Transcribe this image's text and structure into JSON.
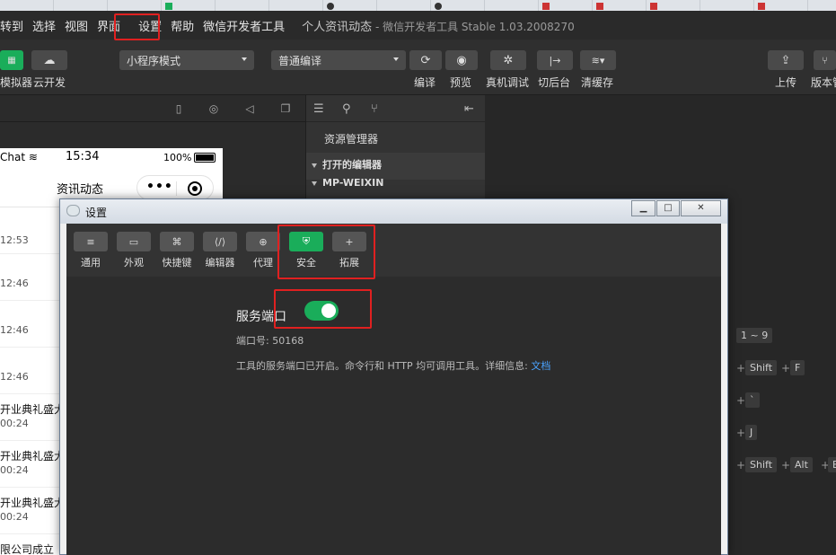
{
  "menubar": {
    "items": [
      "转到",
      "选择",
      "视图",
      "界面",
      "设置",
      "帮助",
      "微信开发者工具"
    ],
    "title": "个人资讯动态",
    "subtitle": "- 微信开发者工具 Stable 1.03.2008270"
  },
  "toolbar": {
    "simulator_label": "模拟器",
    "cloud_label": "云开发",
    "mode_select": "小程序模式",
    "compile_select": "普通编译",
    "compile_label": "编译",
    "preview_label": "预览",
    "remote_debug_label": "真机调试",
    "background_label": "切后台",
    "clear_cache_label": "清缓存",
    "upload_label": "上传",
    "version_label": "版本管"
  },
  "phone": {
    "carrier": "Chat",
    "time": "15:34",
    "battery": "100%",
    "nav_title": "资讯动态",
    "items": [
      {
        "title": "",
        "time": "12:53"
      },
      {
        "title": "",
        "time": "12:46"
      },
      {
        "title": "",
        "time": "12:46"
      },
      {
        "title": "",
        "time": "12:46"
      },
      {
        "title": "开业典礼盛大",
        "time": "00:24"
      },
      {
        "title": "开业典礼盛大",
        "time": "00:24"
      },
      {
        "title": "开业典礼盛大",
        "time": "00:24"
      },
      {
        "title": "限公司成立",
        "time": ""
      }
    ]
  },
  "explorer": {
    "title": "资源管理器",
    "open_editors": "打开的编辑器",
    "project": "MP-WEIXIN"
  },
  "shortcuts": {
    "k1": "1 ~ 9",
    "k2a": "Shift",
    "k2b": "F",
    "k3": "`",
    "k4": "J",
    "k5a": "Shift",
    "k5b": "Alt",
    "k5c": "E",
    "plus": "+"
  },
  "dialog": {
    "title": "设置",
    "tabs": [
      {
        "label": "通用",
        "icon": "≡"
      },
      {
        "label": "外观",
        "icon": "▭"
      },
      {
        "label": "快捷键",
        "icon": "⌘"
      },
      {
        "label": "编辑器",
        "icon": "⟨/⟩"
      },
      {
        "label": "代理",
        "icon": "⊕"
      },
      {
        "label": "安全",
        "icon": "⛨"
      },
      {
        "label": "拓展",
        "icon": "+"
      }
    ],
    "service_port_title": "服务端口",
    "port_text": "端口号: 50168",
    "description": "工具的服务端口已开启。命令行和 HTTP 均可调用工具。详细信息:",
    "docs_link": "文档",
    "toggle_on": true
  },
  "colors": {
    "accent_green": "#1aad5a",
    "highlight_red": "#e02020",
    "link_blue": "#4aa3ff"
  }
}
